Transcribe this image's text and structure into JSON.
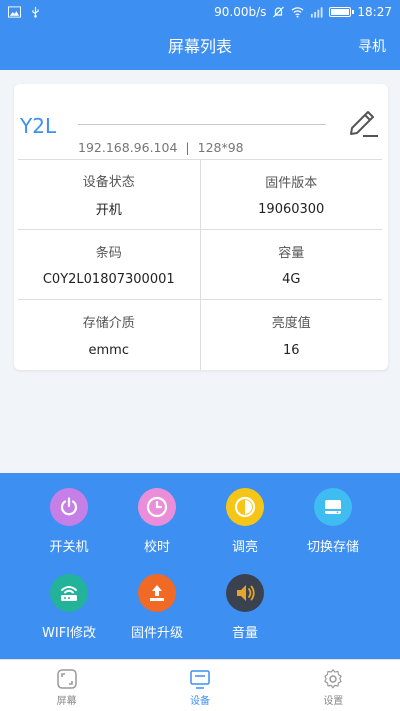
{
  "status_bar": {
    "speed": "90.00b/s",
    "time": "18:27"
  },
  "app_bar": {
    "title": "屏幕列表",
    "action_label": "寻机"
  },
  "device": {
    "name": "Y2L",
    "ip": "192.168.96.104",
    "resolution": "128*98",
    "separator": "|",
    "fields": [
      {
        "label": "设备状态",
        "value": "开机"
      },
      {
        "label": "固件版本",
        "value": "19060300"
      },
      {
        "label": "条码",
        "value": "C0Y2L01807300001"
      },
      {
        "label": "容量",
        "value": "4G"
      },
      {
        "label": "存储介质",
        "value": "emmc"
      },
      {
        "label": "亮度值",
        "value": "16"
      }
    ]
  },
  "actions": [
    {
      "label": "开关机",
      "icon": "power-icon",
      "color": "#c77fe8"
    },
    {
      "label": "校时",
      "icon": "clock-icon",
      "color": "#ea8ed9"
    },
    {
      "label": "调亮",
      "icon": "brightness-icon",
      "color": "#f5c518"
    },
    {
      "label": "切换存储",
      "icon": "storage-icon",
      "color": "#3fbdf0"
    },
    {
      "label": "WIFI修改",
      "icon": "router-icon",
      "color": "#22b39a"
    },
    {
      "label": "固件升级",
      "icon": "upload-icon",
      "color": "#f06a25"
    },
    {
      "label": "音量",
      "icon": "volume-icon",
      "color": "#3a4250"
    }
  ],
  "bottom_nav": [
    {
      "label": "屏幕",
      "icon": "screen-icon",
      "active": false
    },
    {
      "label": "设备",
      "icon": "device-icon",
      "active": true
    },
    {
      "label": "设置",
      "icon": "settings-icon",
      "active": false
    }
  ]
}
